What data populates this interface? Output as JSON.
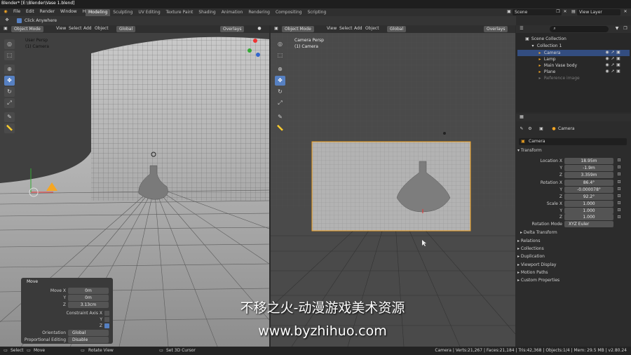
{
  "title": "Blender* [E:\\Blender\\Vase 1.blend]",
  "menus": [
    "File",
    "Edit",
    "Render",
    "Window",
    "Help"
  ],
  "workspaces": [
    "Modeling",
    "Sculpting",
    "UV Editing",
    "Texture Paint",
    "Shading",
    "Animation",
    "Rendering",
    "Compositing",
    "Scripting"
  ],
  "scene": "Scene",
  "view_layer": "View Layer",
  "tool_header": {
    "label": "Click Anywhere"
  },
  "left_view": {
    "mode": "Object Mode",
    "menus": [
      "View",
      "Select",
      "Add",
      "Object"
    ],
    "transform": "Global",
    "overlays": "Overlays",
    "info_line1": "User Persp",
    "info_line2": "(1) Camera"
  },
  "right_view": {
    "mode": "Object Mode",
    "menus": [
      "View",
      "Select",
      "Add",
      "Object"
    ],
    "transform": "Global",
    "overlays": "Overlays",
    "info_line1": "Camera Persp",
    "info_line2": "(1) Camera"
  },
  "move_panel": {
    "title": "Move",
    "move_x_label": "Move X",
    "move_x": "0m",
    "y_label": "Y",
    "y": "0m",
    "z_label": "Z",
    "z": "3.13cm",
    "constraint_label": "Constraint Axis X",
    "cy": "Y",
    "cz": "Z",
    "orientation_label": "Orientation",
    "orientation": "Global",
    "prop_label": "Proportional Editing",
    "prop": "Disable"
  },
  "outliner": {
    "root": "Scene Collection",
    "collection": "Collection 1",
    "items": [
      "Camera",
      "Lamp",
      "Main Vase body",
      "Plane",
      "Reference image"
    ]
  },
  "properties": {
    "object_name": "Camera",
    "name_field": "Camera",
    "transform_header": "Transform",
    "loc_x_label": "Location X",
    "loc_x": "18.95m",
    "loc_y_label": "Y",
    "loc_y": "-1.9m",
    "loc_z_label": "Z",
    "loc_z": "3.359m",
    "rot_x_label": "Rotation X",
    "rot_x": "86.4°",
    "rot_y_label": "Y",
    "rot_y": "-0.000078°",
    "rot_z_label": "Z",
    "rot_z": "92.2°",
    "scale_x_label": "Scale X",
    "scale_x": "1.000",
    "scale_y_label": "Y",
    "scale_y": "1.000",
    "scale_z_label": "Z",
    "scale_z": "1.000",
    "rot_mode_label": "Rotation Mode",
    "rot_mode": "XYZ Euler",
    "sections": [
      "Delta Transform",
      "Relations",
      "Collections",
      "Duplication",
      "Viewport Display",
      "Motion Paths",
      "Custom Properties"
    ]
  },
  "status_bar": {
    "select": "Select",
    "move": "Move",
    "rotate": "Rotate View",
    "cursor": "Set 3D Cursor",
    "stats": "Camera | Verts:21,267 | Faces:21,184 | Tris:42,368 | Objects:1/4 | Mem: 29.5 MB | v2.80.24"
  },
  "watermark": {
    "line1": "不移之火-动漫游戏美术资源",
    "line2": "www.byzhihuo.com"
  },
  "colors": {
    "accent": "#5680c2",
    "selection": "#f5a623"
  }
}
